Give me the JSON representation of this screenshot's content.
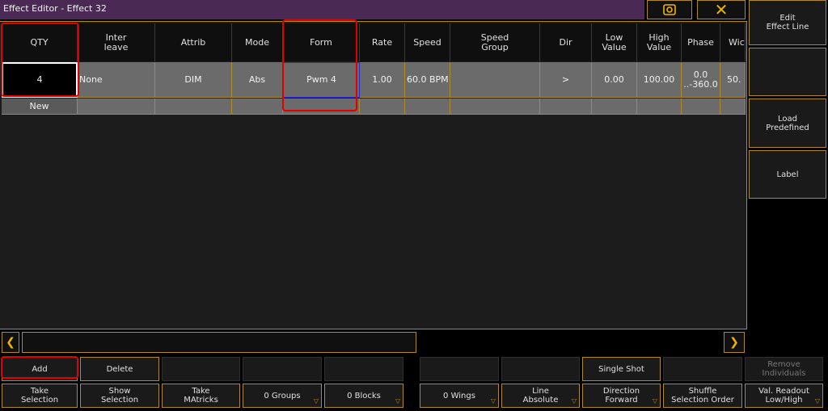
{
  "window": {
    "title": "Effect Editor - Effect 32",
    "close_glyph": "✕"
  },
  "table": {
    "headers": [
      "QTY",
      "Inter\nleave",
      "Attrib",
      "Mode",
      "Form",
      "Rate",
      "Speed",
      "Speed\nGroup",
      "Dir",
      "Low\nValue",
      "High\nValue",
      "Phase",
      "Wic"
    ],
    "row": [
      "4",
      "None",
      "DIM",
      "Abs",
      "Pwm 4",
      "1.00",
      "60.0 BPM",
      "",
      ">",
      "0.00",
      "100.00",
      "0.0\n..-360.0",
      "50."
    ],
    "new_label": "New"
  },
  "bottom": {
    "row1": {
      "add": "Add",
      "delete": "Delete",
      "single_shot": "Single Shot",
      "remove_individuals": "Remove\nIndividuals"
    },
    "row2": {
      "take_selection": "Take\nSelection",
      "show_selection": "Show\nSelection",
      "take_matricks": "Take\nMAtricks",
      "groups": "0 Groups",
      "blocks": "0 Blocks",
      "wings": "0 Wings",
      "line_absolute": "Line\nAbsolute",
      "direction_forward": "Direction\nForward",
      "shuffle": "Shuffle\nSelection Order",
      "val_readout": "Val. Readout\nLow/High"
    }
  },
  "side": {
    "edit_effect_line": "Edit\nEffect Line",
    "load_predefined": "Load\nPredefined",
    "label": "Label"
  },
  "colors": {
    "title_bg": "#4a2a55",
    "border_gold": "#b08a2a",
    "annotation_red": "#e00000"
  }
}
